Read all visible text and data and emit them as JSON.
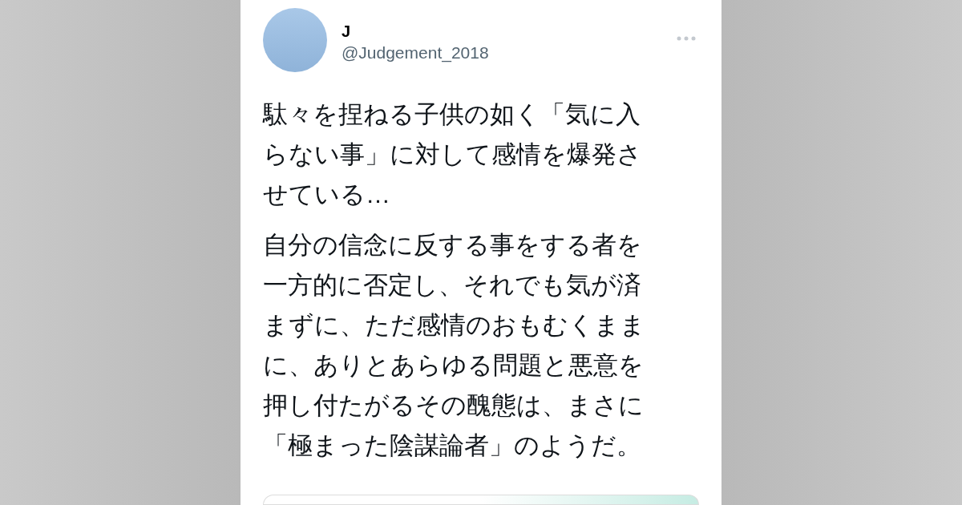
{
  "tweet": {
    "name": "J",
    "handle": "@Judgement_2018",
    "paragraphs": [
      "駄々を捏ねる子供の如く「気に入らない事」に対して感情を爆発させている…",
      "自分の信念に反する事をする者を一方的に否定し、それでも気が済まずに、ただ感情のおもむくままに、ありとあらゆる問題と悪意を押し付たがるその醜態は、まさに「極まった陰謀論者」のようだ。"
    ]
  }
}
